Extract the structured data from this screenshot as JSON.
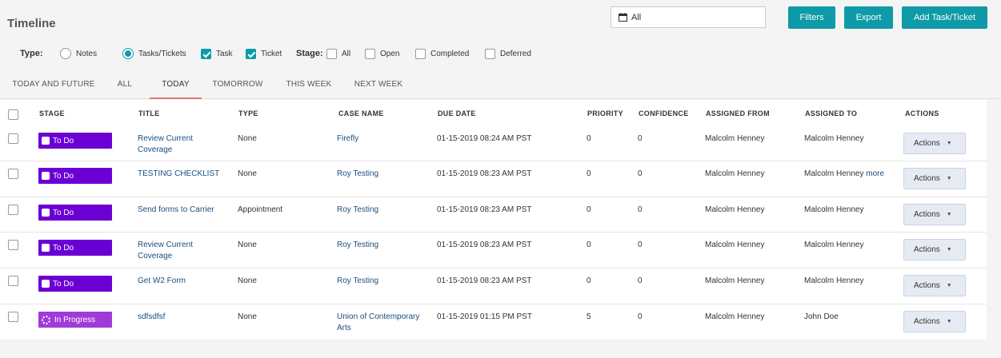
{
  "header": {
    "title": "Timeline"
  },
  "search": {
    "value": "All"
  },
  "toolbar": {
    "filters_label": "Filters",
    "export_label": "Export",
    "add_label": "Add Task/Ticket"
  },
  "filters": {
    "type_label": "Type:",
    "notes_label": "Notes",
    "tasks_tickets_label": "Tasks/Tickets",
    "task_label": "Task",
    "ticket_label": "Ticket",
    "stage_label": "Stage:",
    "all_label": "All",
    "open_label": "Open",
    "completed_label": "Completed",
    "deferred_label": "Deferred"
  },
  "tabs": [
    "TODAY AND FUTURE",
    "ALL",
    "TODAY",
    "TOMORROW",
    "THIS WEEK",
    "NEXT WEEK"
  ],
  "columns": [
    "STAGE",
    "TITLE",
    "TYPE",
    "CASE NAME",
    "DUE DATE",
    "PRIORITY",
    "CONFIDENCE",
    "ASSIGNED FROM",
    "ASSIGNED TO",
    "ACTIONS"
  ],
  "rows": [
    {
      "stage": "To Do",
      "title": "Review Current Coverage",
      "type": "None",
      "case": "Firefly",
      "due": "01-15-2019 08:24 AM PST",
      "priority": "0",
      "confidence": "0",
      "from": "Malcolm Henney",
      "to": "Malcolm Henney",
      "to_more": "",
      "action": "Actions"
    },
    {
      "stage": "To Do",
      "title": "TESTING CHECKLIST",
      "type": "None",
      "case": "Roy Testing",
      "due": "01-15-2019 08:23 AM PST",
      "priority": "0",
      "confidence": "0",
      "from": "Malcolm Henney",
      "to": "Malcolm Henney",
      "to_more": "more",
      "action": "Actions"
    },
    {
      "stage": "To Do",
      "title": "Send forms to Carrier",
      "type": "Appointment",
      "case": "Roy Testing",
      "due": "01-15-2019 08:23 AM PST",
      "priority": "0",
      "confidence": "0",
      "from": "Malcolm Henney",
      "to": "Malcolm Henney",
      "to_more": "",
      "action": "Actions"
    },
    {
      "stage": "To Do",
      "title": "Review Current Coverage",
      "type": "None",
      "case": "Roy Testing",
      "due": "01-15-2019 08:23 AM PST",
      "priority": "0",
      "confidence": "0",
      "from": "Malcolm Henney",
      "to": "Malcolm Henney",
      "to_more": "",
      "action": "Actions"
    },
    {
      "stage": "To Do",
      "title": "Get W2 Form",
      "type": "None",
      "case": "Roy Testing",
      "due": "01-15-2019 08:23 AM PST",
      "priority": "0",
      "confidence": "0",
      "from": "Malcolm Henney",
      "to": "Malcolm Henney",
      "to_more": "",
      "action": "Actions"
    },
    {
      "stage": "In Progress",
      "title": "sdfsdfsf",
      "type": "None",
      "case": "Union of Contemporary Arts",
      "due": "01-15-2019 01:15 PM PST",
      "priority": "5",
      "confidence": "0",
      "from": "Malcolm Henney",
      "to": "John Doe",
      "to_more": "",
      "action": "Actions"
    }
  ],
  "colors": {
    "accent": "#0e9aa7",
    "todo": "#6a00d4",
    "in_progress": "#a03ad8",
    "tab_underline": "#e0736f"
  }
}
